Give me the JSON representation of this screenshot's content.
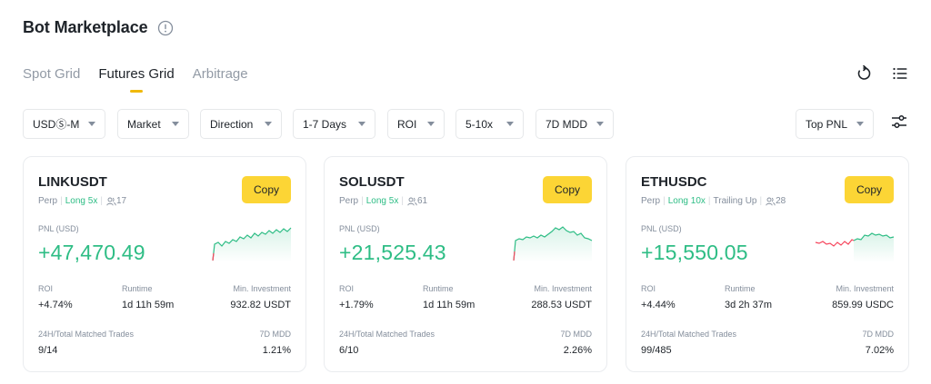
{
  "page": {
    "title": "Bot Marketplace",
    "info_icon": "info-icon"
  },
  "tabs": [
    {
      "label": "Spot Grid",
      "active": false
    },
    {
      "label": "Futures Grid",
      "active": true
    },
    {
      "label": "Arbitrage",
      "active": false
    }
  ],
  "toolbar": {
    "refresh_icon": "refresh-icon",
    "list_icon": "list-icon",
    "settings_icon": "sliders-icon"
  },
  "filters": {
    "margin": "USDⓈ-M",
    "market": "Market",
    "direction": "Direction",
    "runtime": "1-7 Days",
    "roi": "ROI",
    "leverage": "5-10x",
    "mdd": "7D MDD",
    "sort": "Top PNL"
  },
  "labels": {
    "pnl": "PNL (USD)",
    "roi": "ROI",
    "runtime": "Runtime",
    "min_investment": "Min. Investment",
    "matched_trades": "24H/Total Matched Trades",
    "mdd": "7D MDD",
    "copy": "Copy"
  },
  "colors": {
    "accent": "#fcd535",
    "positive": "#2ebd85",
    "negative": "#f6465d"
  },
  "cards": [
    {
      "symbol": "LINKUSDT",
      "type": "Perp",
      "direction": "Long 5x",
      "extra": "",
      "users": "17",
      "pnl": "+47,470.49",
      "roi": "+4.74%",
      "runtime": "1d 11h 59m",
      "min_investment": "932.82 USDT",
      "matched_trades": "9/14",
      "mdd": "1.21%"
    },
    {
      "symbol": "SOLUSDT",
      "type": "Perp",
      "direction": "Long 5x",
      "extra": "",
      "users": "61",
      "pnl": "+21,525.43",
      "roi": "+1.79%",
      "runtime": "1d 11h 59m",
      "min_investment": "288.53 USDT",
      "matched_trades": "6/10",
      "mdd": "2.26%"
    },
    {
      "symbol": "ETHUSDC",
      "type": "Perp",
      "direction": "Long 10x",
      "extra": "Trailing Up",
      "users": "28",
      "pnl": "+15,550.05",
      "roi": "+4.44%",
      "runtime": "3d 2h 37m",
      "min_investment": "859.99 USDC",
      "matched_trades": "99/485",
      "mdd": "7.02%"
    }
  ]
}
